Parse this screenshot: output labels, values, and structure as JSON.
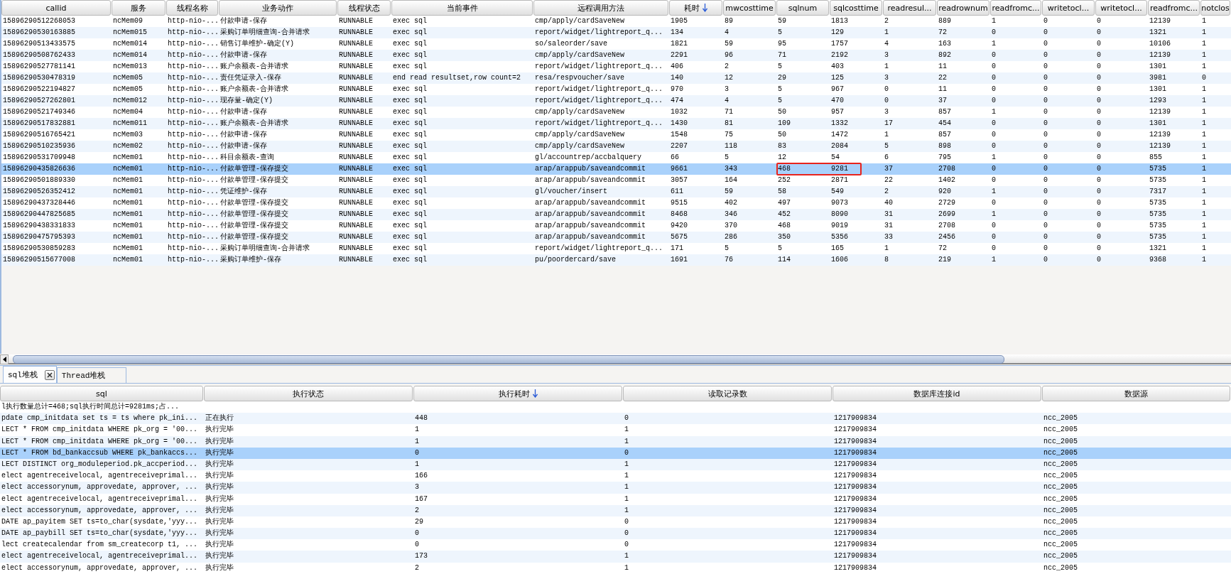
{
  "top_table": {
    "columns": [
      {
        "label": "callid",
        "sorted": false,
        "marked": false
      },
      {
        "label": "服务",
        "sorted": false,
        "marked": false
      },
      {
        "label": "线程名称",
        "sorted": false,
        "marked": false
      },
      {
        "label": "业务动作",
        "sorted": false,
        "marked": false
      },
      {
        "label": "线程状态",
        "sorted": false,
        "marked": false
      },
      {
        "label": "当前事件",
        "sorted": false,
        "marked": false
      },
      {
        "label": "远程调用方法",
        "sorted": false,
        "marked": false
      },
      {
        "label": "耗时",
        "sorted": true,
        "marked": false
      },
      {
        "label": "mwcosttime",
        "sorted": false,
        "marked": false
      },
      {
        "label": "sqlnum",
        "sorted": false,
        "marked": true
      },
      {
        "label": "sqlcosttime",
        "sorted": false,
        "marked": true
      },
      {
        "label": "readresul...",
        "sorted": false,
        "marked": false
      },
      {
        "label": "readrownum",
        "sorted": false,
        "marked": false
      },
      {
        "label": "readfromc...",
        "sorted": false,
        "marked": false
      },
      {
        "label": "writetocl...",
        "sorted": false,
        "marked": false
      },
      {
        "label": "writetocl...",
        "sorted": false,
        "marked": false
      },
      {
        "label": "readfromc...",
        "sorted": false,
        "marked": false
      },
      {
        "label": "notclos",
        "sorted": false,
        "marked": false
      }
    ],
    "rows": [
      {
        "selected": false,
        "marked": false,
        "cells": [
          "15896290512268053",
          "ncMem09",
          "http-nio-...",
          "付款申请-保存",
          "RUNNABLE",
          "exec sql",
          "cmp/apply/cardSaveNew",
          "1905",
          "89",
          "59",
          "1813",
          "2",
          "889",
          "1",
          "0",
          "0",
          "12139",
          "1"
        ]
      },
      {
        "selected": false,
        "marked": false,
        "cells": [
          "15896290530163885",
          "ncMem015",
          "http-nio-...",
          "采购订单明细查询-合并请求",
          "RUNNABLE",
          "exec sql",
          "report/widget/lightreport_q...",
          "134",
          "4",
          "5",
          "129",
          "1",
          "72",
          "0",
          "0",
          "0",
          "1321",
          "1"
        ]
      },
      {
        "selected": false,
        "marked": false,
        "cells": [
          "15896290513433575",
          "ncMem014",
          "http-nio-...",
          "销售订单维护-确定(Y)",
          "RUNNABLE",
          "exec sql",
          "so/saleorder/save",
          "1821",
          "59",
          "95",
          "1757",
          "4",
          "163",
          "1",
          "0",
          "0",
          "10106",
          "1"
        ]
      },
      {
        "selected": false,
        "marked": false,
        "cells": [
          "15896290508762433",
          "ncMem014",
          "http-nio-...",
          "付款申请-保存",
          "RUNNABLE",
          "exec sql",
          "cmp/apply/cardSaveNew",
          "2291",
          "96",
          "71",
          "2192",
          "3",
          "892",
          "0",
          "0",
          "0",
          "12139",
          "1"
        ]
      },
      {
        "selected": false,
        "marked": false,
        "cells": [
          "15896290527781141",
          "ncMem013",
          "http-nio-...",
          "账户余额表-合并请求",
          "RUNNABLE",
          "exec sql",
          "report/widget/lightreport_q...",
          "406",
          "2",
          "5",
          "403",
          "1",
          "11",
          "0",
          "0",
          "0",
          "1301",
          "1"
        ]
      },
      {
        "selected": false,
        "marked": false,
        "cells": [
          "15896290530478319",
          "ncMem05",
          "http-nio-...",
          "责任凭证录入-保存",
          "RUNNABLE",
          "end read resultset,row count=2",
          "resa/respvoucher/save",
          "140",
          "12",
          "29",
          "125",
          "3",
          "22",
          "0",
          "0",
          "0",
          "3981",
          "0"
        ]
      },
      {
        "selected": false,
        "marked": false,
        "cells": [
          "15896290522194827",
          "ncMem05",
          "http-nio-...",
          "账户余额表-合并请求",
          "RUNNABLE",
          "exec sql",
          "report/widget/lightreport_q...",
          "970",
          "3",
          "5",
          "967",
          "0",
          "11",
          "0",
          "0",
          "0",
          "1301",
          "1"
        ]
      },
      {
        "selected": false,
        "marked": false,
        "cells": [
          "15896290527262801",
          "ncMem012",
          "http-nio-...",
          "现存量-确定(Y)",
          "RUNNABLE",
          "exec sql",
          "report/widget/lightreport_q...",
          "474",
          "4",
          "5",
          "470",
          "0",
          "37",
          "0",
          "0",
          "0",
          "1293",
          "1"
        ]
      },
      {
        "selected": false,
        "marked": false,
        "cells": [
          "15896290521749346",
          "ncMem04",
          "http-nio-...",
          "付款申请-保存",
          "RUNNABLE",
          "exec sql",
          "cmp/apply/cardSaveNew",
          "1032",
          "71",
          "50",
          "957",
          "3",
          "857",
          "1",
          "0",
          "0",
          "12139",
          "1"
        ]
      },
      {
        "selected": false,
        "marked": false,
        "cells": [
          "15896290517832881",
          "ncMem011",
          "http-nio-...",
          "账户余额表-合并请求",
          "RUNNABLE",
          "exec sql",
          "report/widget/lightreport_q...",
          "1430",
          "81",
          "109",
          "1332",
          "17",
          "454",
          "0",
          "0",
          "0",
          "1301",
          "1"
        ]
      },
      {
        "selected": false,
        "marked": false,
        "cells": [
          "15896290516765421",
          "ncMem03",
          "http-nio-...",
          "付款申请-保存",
          "RUNNABLE",
          "exec sql",
          "cmp/apply/cardSaveNew",
          "1548",
          "75",
          "50",
          "1472",
          "1",
          "857",
          "0",
          "0",
          "0",
          "12139",
          "1"
        ]
      },
      {
        "selected": false,
        "marked": false,
        "cells": [
          "15896290510235936",
          "ncMem02",
          "http-nio-...",
          "付款申请-保存",
          "RUNNABLE",
          "exec sql",
          "cmp/apply/cardSaveNew",
          "2207",
          "118",
          "83",
          "2084",
          "5",
          "898",
          "0",
          "0",
          "0",
          "12139",
          "1"
        ]
      },
      {
        "selected": false,
        "marked": false,
        "cells": [
          "15896290531709948",
          "ncMem01",
          "http-nio-...",
          "科目余额表-查询",
          "RUNNABLE",
          "exec sql",
          "gl/accountrep/accbalquery",
          "66",
          "5",
          "12",
          "54",
          "6",
          "795",
          "1",
          "0",
          "0",
          "855",
          "1"
        ]
      },
      {
        "selected": true,
        "marked": true,
        "cells": [
          "15896290435826636",
          "ncMem01",
          "http-nio-...",
          "付款单管理-保存提交",
          "RUNNABLE",
          "exec sql",
          "arap/arappub/saveandcommit",
          "9661",
          "343",
          "468",
          "9281",
          "37",
          "2708",
          "0",
          "0",
          "0",
          "5735",
          "1"
        ]
      },
      {
        "selected": false,
        "marked": false,
        "cells": [
          "15896290501889330",
          "ncMem01",
          "http-nio-...",
          "付款单管理-保存提交",
          "RUNNABLE",
          "exec sql",
          "arap/arappub/saveandcommit",
          "3057",
          "164",
          "252",
          "2871",
          "22",
          "1402",
          "0",
          "0",
          "0",
          "5735",
          "1"
        ]
      },
      {
        "selected": false,
        "marked": false,
        "cells": [
          "15896290526352412",
          "ncMem01",
          "http-nio-...",
          "凭证维护-保存",
          "RUNNABLE",
          "exec sql",
          "gl/voucher/insert",
          "611",
          "59",
          "58",
          "549",
          "2",
          "920",
          "1",
          "0",
          "0",
          "7317",
          "1"
        ]
      },
      {
        "selected": false,
        "marked": false,
        "cells": [
          "15896290437328446",
          "ncMem01",
          "http-nio-...",
          "付款单管理-保存提交",
          "RUNNABLE",
          "exec sql",
          "arap/arappub/saveandcommit",
          "9515",
          "402",
          "497",
          "9073",
          "40",
          "2729",
          "0",
          "0",
          "0",
          "5735",
          "1"
        ]
      },
      {
        "selected": false,
        "marked": false,
        "cells": [
          "15896290447825685",
          "ncMem01",
          "http-nio-...",
          "付款单管理-保存提交",
          "RUNNABLE",
          "exec sql",
          "arap/arappub/saveandcommit",
          "8468",
          "346",
          "452",
          "8090",
          "31",
          "2699",
          "1",
          "0",
          "0",
          "5735",
          "1"
        ]
      },
      {
        "selected": false,
        "marked": false,
        "cells": [
          "15896290438331833",
          "ncMem01",
          "http-nio-...",
          "付款单管理-保存提交",
          "RUNNABLE",
          "exec sql",
          "arap/arappub/saveandcommit",
          "9420",
          "370",
          "468",
          "9019",
          "31",
          "2708",
          "0",
          "0",
          "0",
          "5735",
          "1"
        ]
      },
      {
        "selected": false,
        "marked": false,
        "cells": [
          "15896290475795393",
          "ncMem01",
          "http-nio-...",
          "付款单管理-保存提交",
          "RUNNABLE",
          "exec sql",
          "arap/arappub/saveandcommit",
          "5675",
          "286",
          "350",
          "5356",
          "33",
          "2456",
          "0",
          "0",
          "0",
          "5735",
          "1"
        ]
      },
      {
        "selected": false,
        "marked": false,
        "cells": [
          "15896290530859283",
          "ncMem01",
          "http-nio-...",
          "采购订单明细查询-合并请求",
          "RUNNABLE",
          "exec sql",
          "report/widget/lightreport_q...",
          "171",
          "5",
          "5",
          "165",
          "1",
          "72",
          "0",
          "0",
          "0",
          "1321",
          "1"
        ]
      },
      {
        "selected": false,
        "marked": false,
        "cells": [
          "15896290515677008",
          "ncMem01",
          "http-nio-...",
          "采购订单维护-保存",
          "RUNNABLE",
          "exec sql",
          "pu/poordercard/save",
          "1691",
          "76",
          "114",
          "1606",
          "8",
          "219",
          "1",
          "0",
          "0",
          "9368",
          "1"
        ]
      }
    ]
  },
  "tabs": [
    {
      "label": "sql堆栈",
      "selected": true,
      "closable": true
    },
    {
      "label": "Thread堆栈",
      "selected": false,
      "closable": false
    }
  ],
  "sql_table": {
    "columns": [
      {
        "label": "sql",
        "sorted": false
      },
      {
        "label": "执行状态",
        "sorted": false
      },
      {
        "label": "执行耗时",
        "sorted": true
      },
      {
        "label": "读取记录数",
        "sorted": false
      },
      {
        "label": "数据库连接id",
        "sorted": false
      },
      {
        "label": "数据源",
        "sorted": false
      }
    ],
    "rows": [
      {
        "selected": false,
        "cells": [
          "l执行数量总计=468;sql执行时间总计=9281ms;占..."
        ]
      },
      {
        "selected": false,
        "cells": [
          "pdate cmp_initdata set ts = ts where pk_ini...",
          "正在执行",
          "448",
          "0",
          "1217909834",
          "ncc_2005"
        ]
      },
      {
        "selected": false,
        "cells": [
          "LECT * FROM cmp_initdata WHERE pk_org = '00...",
          "执行完毕",
          "1",
          "1",
          "1217909834",
          "ncc_2005"
        ]
      },
      {
        "selected": false,
        "cells": [
          "LECT * FROM cmp_initdata WHERE pk_org = '00...",
          "执行完毕",
          "1",
          "1",
          "1217909834",
          "ncc_2005"
        ]
      },
      {
        "selected": true,
        "cells": [
          "LECT * FROM bd_bankaccsub WHERE pk_bankaccs...",
          "执行完毕",
          "0",
          "0",
          "1217909834",
          "ncc_2005"
        ]
      },
      {
        "selected": false,
        "cells": [
          "LECT DISTINCT org_moduleperiod.pk_accperiod...",
          "执行完毕",
          "1",
          "1",
          "1217909834",
          "ncc_2005"
        ]
      },
      {
        "selected": false,
        "cells": [
          "elect agentreceivelocal, agentreceiveprimal...",
          "执行完毕",
          "166",
          "1",
          "1217909834",
          "ncc_2005"
        ]
      },
      {
        "selected": false,
        "cells": [
          "elect accessorynum, approvedate, approver, ...",
          "执行完毕",
          "3",
          "1",
          "1217909834",
          "ncc_2005"
        ]
      },
      {
        "selected": false,
        "cells": [
          "elect agentreceivelocal, agentreceiveprimal...",
          "执行完毕",
          "167",
          "1",
          "1217909834",
          "ncc_2005"
        ]
      },
      {
        "selected": false,
        "cells": [
          "elect accessorynum, approvedate, approver, ...",
          "执行完毕",
          "2",
          "1",
          "1217909834",
          "ncc_2005"
        ]
      },
      {
        "selected": false,
        "cells": [
          "DATE ap_payitem SET ts=to_char(sysdate,'yyy...",
          "执行完毕",
          "29",
          "0",
          "1217909834",
          "ncc_2005"
        ]
      },
      {
        "selected": false,
        "cells": [
          "DATE ap_paybill SET ts=to_char(sysdate,'yyy...",
          "执行完毕",
          "0",
          "0",
          "1217909834",
          "ncc_2005"
        ]
      },
      {
        "selected": false,
        "cells": [
          "lect createcalendar from sm_createcorp t1, ...",
          "执行完毕",
          "0",
          "0",
          "1217909834",
          "ncc_2005"
        ]
      },
      {
        "selected": false,
        "cells": [
          "elect agentreceivelocal, agentreceiveprimal...",
          "执行完毕",
          "173",
          "1",
          "1217909834",
          "ncc_2005"
        ]
      },
      {
        "selected": false,
        "cells": [
          "elect accessorynum, approvedate, approver, ...",
          "执行完毕",
          "2",
          "1",
          "1217909834",
          "ncc_2005"
        ]
      }
    ]
  }
}
